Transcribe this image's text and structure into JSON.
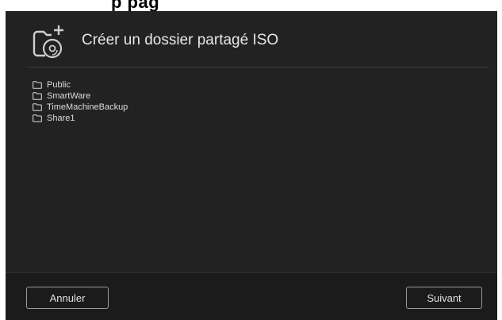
{
  "page_heading_fragment": "p                         pag",
  "dialog": {
    "title": "Créer un dossier partagé ISO",
    "header_icon": "add-iso-share-icon"
  },
  "folders": [
    {
      "label": "Public",
      "icon": "folder-icon"
    },
    {
      "label": "SmartWare",
      "icon": "folder-icon"
    },
    {
      "label": "TimeMachineBackup",
      "icon": "folder-icon"
    },
    {
      "label": "Share1",
      "icon": "folder-icon"
    }
  ],
  "footer": {
    "cancel_label": "Annuler",
    "next_label": "Suivant"
  },
  "colors": {
    "dialog_bg": "#222222",
    "footer_bg": "#1b1b1b",
    "text": "#e6e6e6",
    "button_border": "#9a9a9a"
  }
}
